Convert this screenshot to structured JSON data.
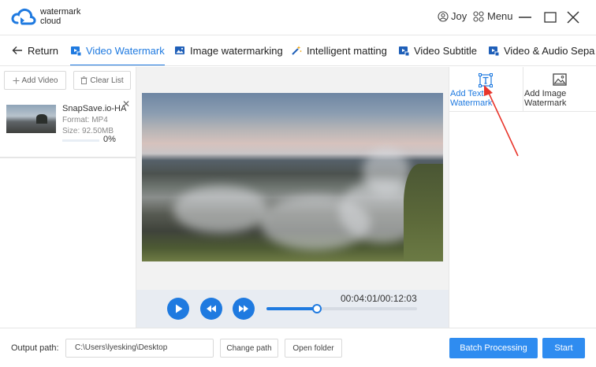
{
  "app": {
    "brand_line1": "watermark",
    "brand_line2": "cloud"
  },
  "window": {
    "user_name": "Joy",
    "menu_label": "Menu"
  },
  "tabs": [
    {
      "label": "Return",
      "icon": "arrow-left-icon"
    },
    {
      "label": "Video Watermark",
      "icon": "video-watermark-icon",
      "active": true
    },
    {
      "label": "Image watermarking",
      "icon": "image-icon"
    },
    {
      "label": "Intelligent matting",
      "icon": "magic-wand-icon"
    },
    {
      "label": "Video Subtitle",
      "icon": "video-subtitle-icon"
    },
    {
      "label": "Video & Audio Sepa",
      "icon": "video-audio-icon"
    }
  ],
  "left_panel": {
    "add_video_label": "Add Video",
    "clear_list_label": "Clear List",
    "file": {
      "name": "SnapSave.io-HA...",
      "format": "Format:  MP4",
      "size": "Size:  92.50MB",
      "progress": "0%",
      "progress_value": 0
    }
  },
  "player": {
    "timecode": "00:04:01/00:12:03",
    "current": "00:04:01",
    "total": "00:12:03"
  },
  "right_panel": {
    "text_watermark_label": "Add Text Watermark",
    "image_watermark_label": "Add Image Watermark"
  },
  "bottom": {
    "output_label": "Output path:",
    "output_path": "C:\\Users\\lyesking\\Desktop",
    "change_path_label": "Change path",
    "open_folder_label": "Open folder",
    "batch_label": "Batch Processing",
    "start_label": "Start"
  },
  "colors": {
    "accent": "#1f7ae0",
    "button": "#2f8cf0",
    "annotation": "#e8352b"
  }
}
